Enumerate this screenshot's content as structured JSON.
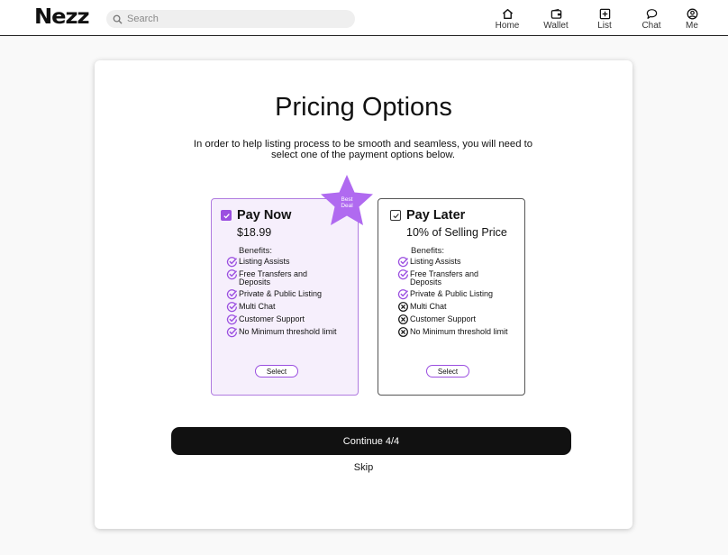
{
  "brand": {
    "logo": "Nezz",
    "accent": "#9b4fe0"
  },
  "search": {
    "placeholder": "Search"
  },
  "nav": {
    "items": [
      {
        "label": "Home",
        "icon": "home-icon"
      },
      {
        "label": "Wallet",
        "icon": "wallet-icon"
      },
      {
        "label": "List",
        "icon": "add-box-icon"
      },
      {
        "label": "Chat",
        "icon": "chat-bubble-icon"
      },
      {
        "label": "Me",
        "icon": "user-circle-icon"
      }
    ]
  },
  "page": {
    "title": "Pricing Options",
    "subtitle": "In order to help listing process to be smooth and seamless, you will need to select one of the payment options below."
  },
  "badge": {
    "line1": "Best",
    "line2": "Deal"
  },
  "plans": [
    {
      "name": "Pay Now",
      "price": "$18.99",
      "checked": true,
      "benefits_label": "Benefits:",
      "benefits": [
        {
          "text": "Listing Assists",
          "included": true
        },
        {
          "text": "Free Transfers and Deposits",
          "included": true
        },
        {
          "text": "Private & Public Listing",
          "included": true
        },
        {
          "text": "Multi Chat",
          "included": true
        },
        {
          "text": "Customer Support",
          "included": true
        },
        {
          "text": "No Minimum threshold limit",
          "included": true
        }
      ],
      "select_label": "Select"
    },
    {
      "name": "Pay Later",
      "price": "10% of Selling Price",
      "checked": false,
      "benefits_label": "Benefits:",
      "benefits": [
        {
          "text": "Listing Assists",
          "included": true
        },
        {
          "text": "Free Transfers and Deposits",
          "included": true
        },
        {
          "text": "Private & Public Listing",
          "included": true
        },
        {
          "text": "Multi Chat",
          "included": false
        },
        {
          "text": "Customer Support",
          "included": false
        },
        {
          "text": "No Minimum threshold limit",
          "included": false
        }
      ],
      "select_label": "Select"
    }
  ],
  "actions": {
    "continue_label": "Continue 4/4",
    "skip_label": "Skip"
  }
}
